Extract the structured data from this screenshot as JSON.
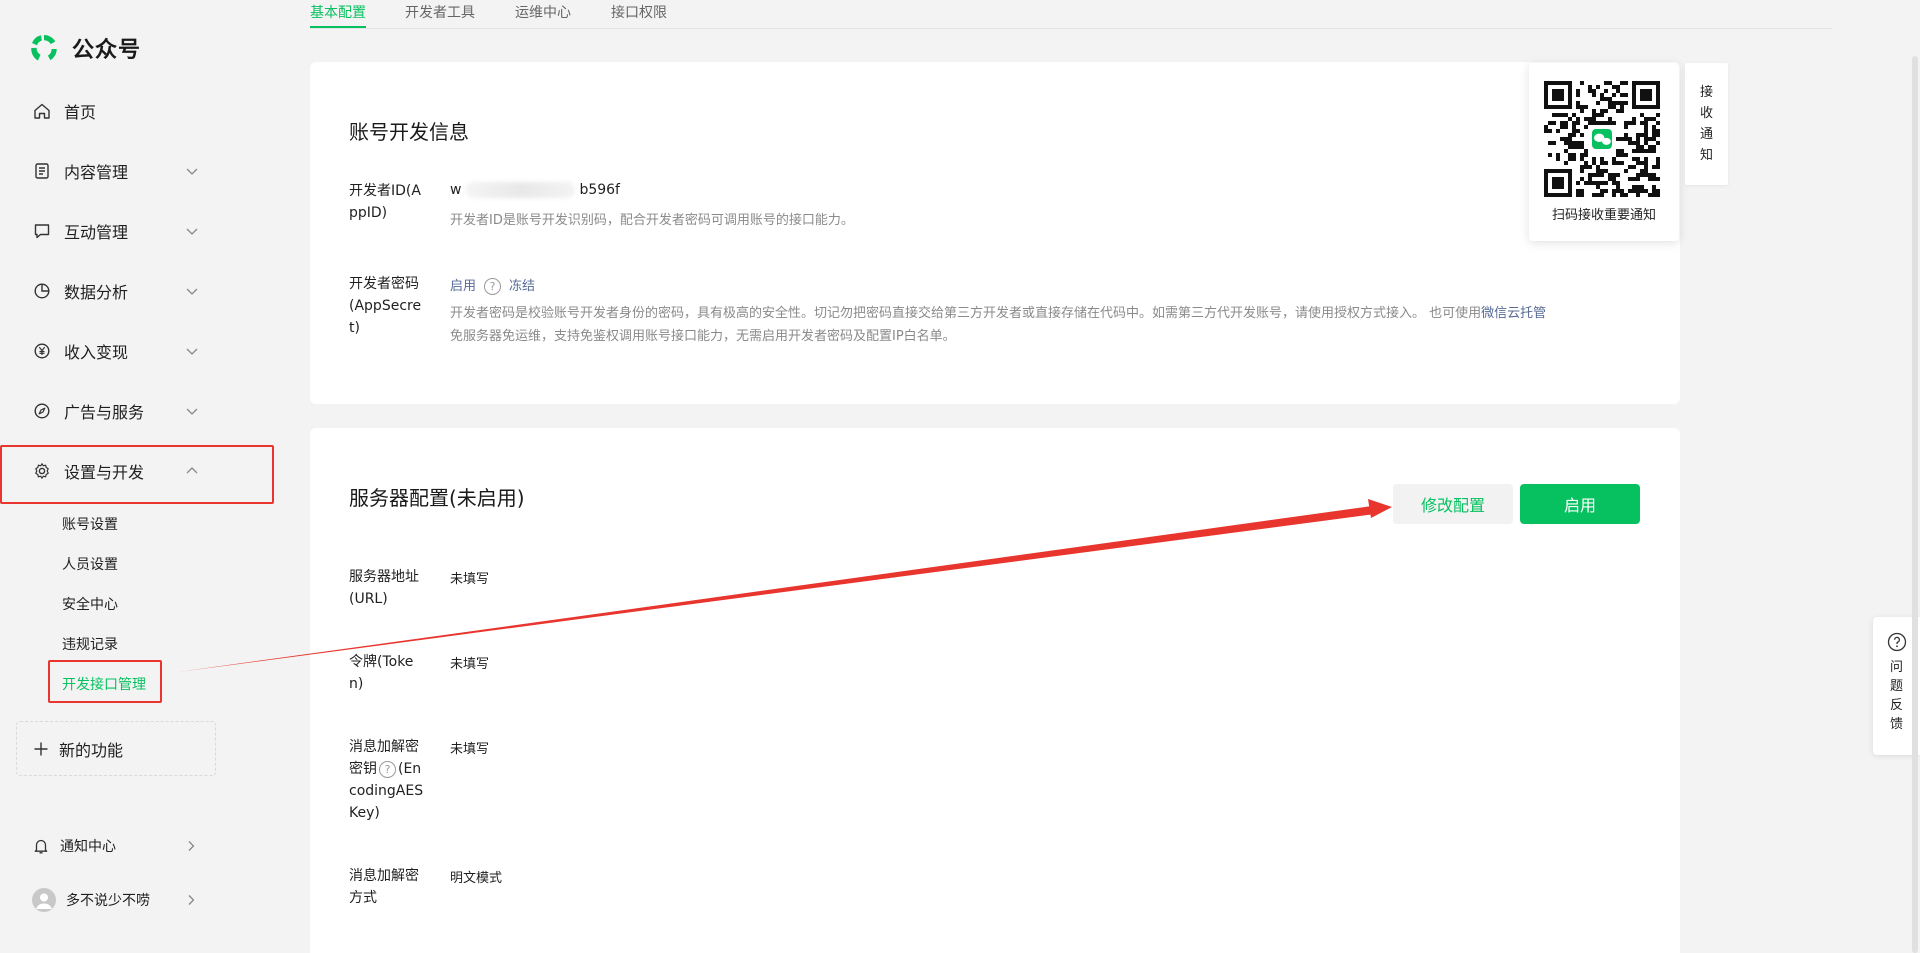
{
  "app": {
    "name": "公众号"
  },
  "nav": {
    "items": [
      {
        "label": "首页",
        "icon": "home-icon"
      },
      {
        "label": "内容管理",
        "icon": "document-icon"
      },
      {
        "label": "互动管理",
        "icon": "chat-icon"
      },
      {
        "label": "数据分析",
        "icon": "pie-chart-icon"
      },
      {
        "label": "收入变现",
        "icon": "yen-icon"
      },
      {
        "label": "广告与服务",
        "icon": "compass-icon"
      },
      {
        "label": "设置与开发",
        "icon": "gear-icon"
      }
    ],
    "sub_items": [
      {
        "label": "账号设置"
      },
      {
        "label": "人员设置"
      },
      {
        "label": "安全中心"
      },
      {
        "label": "违规记录"
      },
      {
        "label": "开发接口管理"
      }
    ],
    "new_feature": "新的功能",
    "notifications": "通知中心",
    "user": "多不说少不唠"
  },
  "tabs": [
    {
      "label": "基本配置",
      "active": true
    },
    {
      "label": "开发者工具"
    },
    {
      "label": "运维中心"
    },
    {
      "label": "接口权限"
    }
  ],
  "dev_info": {
    "title": "账号开发信息",
    "appid": {
      "label": "开发者ID(AppID)",
      "value_prefix": "w",
      "value_suffix": "b596f",
      "desc": "开发者ID是账号开发识别码，配合开发者密码可调用账号的接口能力。"
    },
    "secret": {
      "label": "开发者密码(AppSecret)",
      "enable_link": "启用",
      "freeze_link": "冻结",
      "desc_part1": "开发者密码是校验账号开发者身份的密码，具有极高的安全性。切记勿把密码直接交给第三方开发者或直接存储在代码中。如需第三方代开发账号，请使用授权方式接入。 也可使用",
      "desc_link": "微信云托管",
      "desc_part2": "免服务器免运维，支持免鉴权调用账号接口能力，无需启用开发者密码及配置IP白名单。"
    }
  },
  "server": {
    "title": "服务器配置(未启用)",
    "edit_button": "修改配置",
    "enable_button": "启用",
    "rows": [
      {
        "label": "服务器地址(URL)",
        "value": "未填写"
      },
      {
        "label": "令牌(Token)",
        "value": "未填写"
      },
      {
        "label_part1": "消息加解密密钥",
        "label_part2": "(EncodingAESKey)",
        "value": "未填写"
      },
      {
        "label": "消息加解密方式",
        "value": "明文模式"
      }
    ]
  },
  "qr": {
    "caption": "扫码接收重要通知"
  },
  "notify_tab": [
    "接",
    "收",
    "通",
    "知"
  ],
  "feedback": [
    "问",
    "题",
    "反",
    "馈"
  ],
  "colors": {
    "brand": "#07c160",
    "link": "#576b95",
    "highlight": "#e8352e"
  }
}
